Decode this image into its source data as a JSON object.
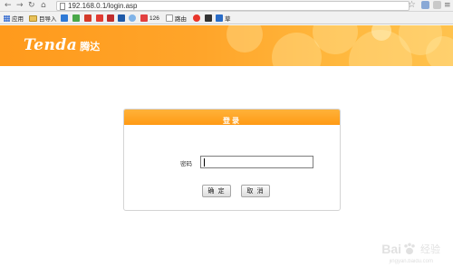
{
  "browser": {
    "url": "192.168.0.1/login.asp",
    "bookmarks": [
      {
        "label": "应用",
        "icon": "apps-grid-icon"
      },
      {
        "label": "目导入",
        "icon": "folder-icon"
      },
      {
        "label": "",
        "icon": "blue-globe-icon"
      },
      {
        "label": "",
        "icon": "green-grid-icon"
      },
      {
        "label": "",
        "icon": "unicom-icon"
      },
      {
        "label": "",
        "icon": "red-tv-icon"
      },
      {
        "label": "",
        "icon": "red-bookmark-icon"
      },
      {
        "label": "",
        "icon": "blue-square-icon"
      },
      {
        "label": "",
        "icon": "cloud-icon"
      },
      {
        "label": "126",
        "icon": "126-mail-icon"
      },
      {
        "label": "路由",
        "icon": "page-icon"
      },
      {
        "label": "",
        "icon": "weibo-icon"
      },
      {
        "label": "",
        "icon": "dark-square-icon"
      },
      {
        "label": "草",
        "icon": "blue-square-icon"
      }
    ]
  },
  "banner": {
    "logo_en": "Tenda",
    "logo_cn": "腾达",
    "colors": {
      "primary": "#ff9a1c",
      "light": "#ffc24d"
    }
  },
  "login": {
    "title": "登录",
    "password_label": "密码",
    "password_value": "",
    "confirm_label": "确 定",
    "cancel_label": "取 消"
  },
  "watermark": {
    "brand_left": "Bai",
    "brand_right": "经验",
    "sub": "jingyan.baidu.com"
  }
}
